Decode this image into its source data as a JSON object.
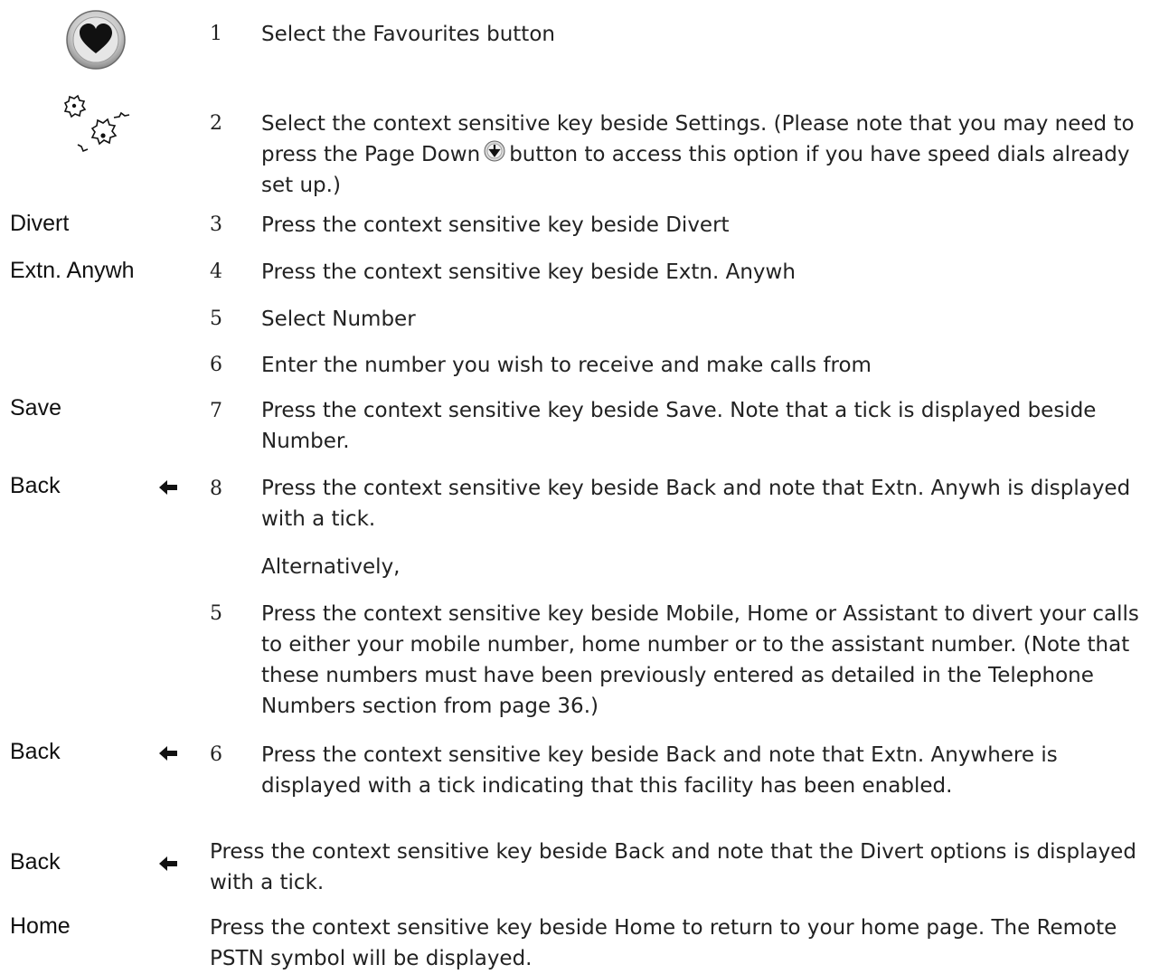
{
  "icons": {
    "favourites": "heart-icon",
    "settings": "settings-gears-icon",
    "page_down": "page-down-icon",
    "back_arrow": "left-arrow-icon"
  },
  "keys": {
    "divert": "Divert",
    "extn_anywh": "Extn. Anywh",
    "save": "Save",
    "back": "Back",
    "home": "Home"
  },
  "steps": {
    "s1": {
      "num": "1",
      "text": "Select the Favourites button"
    },
    "s2": {
      "num": "2",
      "text_a": "Select the context sensitive key beside Settings.  (Please note that you may need to press the Page Down",
      "text_b": "button to access this option if you have speed dials already set up.)"
    },
    "s3": {
      "num": "3",
      "text": "Press the context sensitive key beside Divert"
    },
    "s4": {
      "num": "4",
      "text": "Press the context sensitive key beside Extn. Anywh"
    },
    "s5": {
      "num": "5",
      "text": "Select Number"
    },
    "s6": {
      "num": "6",
      "text": "Enter the number you wish to receive and make calls from"
    },
    "s7": {
      "num": "7",
      "text": "Press the context sensitive key beside Save.  Note that a tick is displayed beside Number."
    },
    "s8": {
      "num": "8",
      "text": "Press the context sensitive key beside Back and note that Extn. Anywh is displayed with a tick."
    },
    "alternatively": "Alternatively,",
    "a5": {
      "num": "5",
      "text": "Press the context sensitive key beside Mobile, Home or Assistant to divert your calls to either your mobile number, home number or to the assistant number.  (Note that these numbers must have been previously entered as detailed in the Telephone Numbers section from page 36.)"
    },
    "a6": {
      "num": "6",
      "text": "Press the context sensitive key beside Back and note that Extn. Anywhere is displayed with a tick indicating that this facility has been enabled."
    },
    "back_final": "Press the context sensitive key beside Back and note that the Divert options is displayed with a tick.",
    "home_final": "Press the context sensitive key beside Home to return to your home page.  The Remote PSTN symbol will be displayed."
  }
}
